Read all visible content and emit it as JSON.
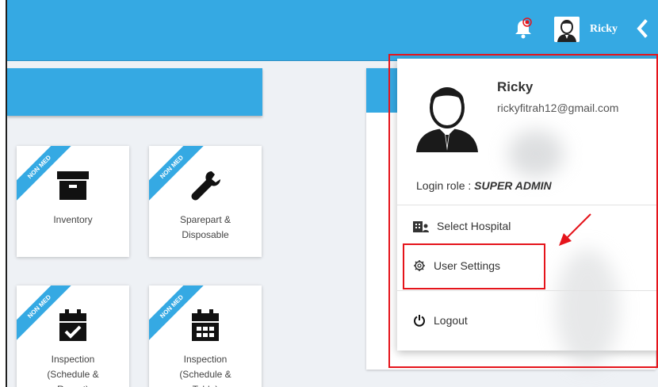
{
  "topbar": {
    "user_name": "Ricky",
    "bell_icon": "bell-icon",
    "chevron_icon": "chevron-left-icon"
  },
  "tiles": [
    {
      "badge": "NON MED",
      "label": "Inventory",
      "icon": "archive-box-icon"
    },
    {
      "badge": "NON MED",
      "label": "Sparepart &\nDisposable",
      "icon": "wrench-icon"
    },
    {
      "badge": "NON MED",
      "label": "Inspection\n(Schedule &\nReport)",
      "icon": "calendar-check-icon"
    },
    {
      "badge": "NON MED",
      "label": "Inspection\n(Schedule &\nTable)",
      "icon": "calendar-grid-icon"
    }
  ],
  "user_menu": {
    "name": "Ricky",
    "email": "rickyfitrah12@gmail.com",
    "role_label": "Login role : ",
    "role_value": "SUPER ADMIN",
    "items": [
      {
        "label": "Select Hospital",
        "icon": "hospital-icon"
      },
      {
        "label": "User Settings",
        "icon": "gear-icon"
      },
      {
        "label": "Logout",
        "icon": "power-icon"
      }
    ]
  },
  "colors": {
    "brand_blue": "#35a9e3",
    "highlight_red": "#e5141b",
    "background": "#eef1f5"
  }
}
